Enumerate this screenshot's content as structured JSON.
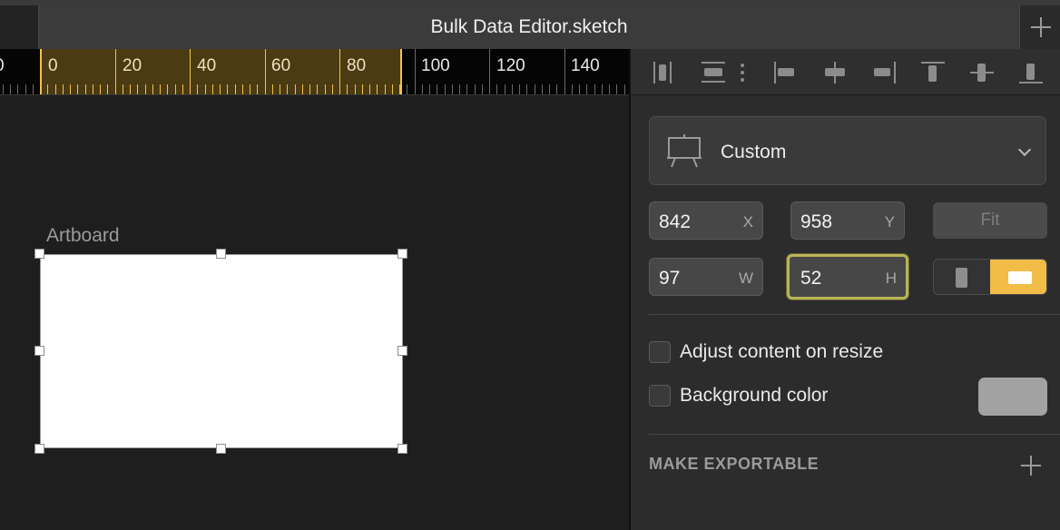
{
  "window": {
    "title": "Bulk Data Editor.sketch"
  },
  "ruler": {
    "labels": [
      "0",
      "0",
      "20",
      "40",
      "60",
      "80",
      "100",
      "120",
      "140"
    ],
    "accent": "#f2c14b"
  },
  "canvas": {
    "artboard_label": "Artboard"
  },
  "inspector": {
    "align_icons": [
      "align-left-icon",
      "align-horizontal-center-icon",
      "more-vertical-icon",
      "align-left-edge-icon",
      "align-center-icon",
      "align-right-edge-icon",
      "align-top-icon",
      "align-middle-icon",
      "align-bottom-icon"
    ],
    "preset": {
      "label": "Custom",
      "icon": "artboard-easel-icon"
    },
    "position": {
      "x": "842",
      "x_suffix": "X",
      "y": "958",
      "y_suffix": "Y"
    },
    "size": {
      "w": "97",
      "w_suffix": "W",
      "h": "52",
      "h_suffix": "H"
    },
    "fit_label": "Fit",
    "orientation": {
      "selected": "landscape"
    },
    "adjust_content_label": "Adjust content on resize",
    "background_color_label": "Background color",
    "background_swatch": "#a2a2a2",
    "export_title": "MAKE EXPORTABLE"
  }
}
